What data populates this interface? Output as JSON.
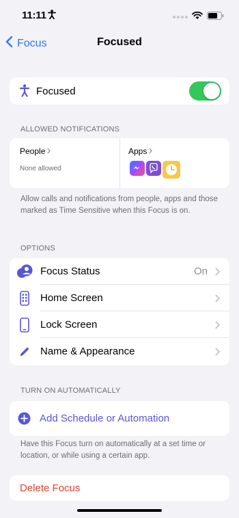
{
  "status_bar": {
    "time": "11:11"
  },
  "nav": {
    "back_label": "Focus",
    "title": "Focused"
  },
  "focus_toggle": {
    "label": "Focused",
    "enabled": true,
    "color": "#34c759"
  },
  "allowed_notifications": {
    "header": "ALLOWED NOTIFICATIONS",
    "people": {
      "title": "People",
      "subtitle": "None allowed"
    },
    "apps": {
      "title": "Apps",
      "icons": [
        "messenger-icon",
        "viber-icon",
        "clock-app-icon"
      ]
    },
    "footer": "Allow calls and notifications from people, apps and those marked as Time Sensitive when this Focus is on."
  },
  "options": {
    "header": "OPTIONS",
    "items": [
      {
        "label": "Focus Status",
        "value": "On",
        "icon": "focus-status-icon"
      },
      {
        "label": "Home Screen",
        "value": "",
        "icon": "home-screen-icon"
      },
      {
        "label": "Lock Screen",
        "value": "",
        "icon": "lock-screen-icon"
      },
      {
        "label": "Name & Appearance",
        "value": "",
        "icon": "pencil-icon"
      }
    ]
  },
  "turn_on_automatically": {
    "header": "TURN ON AUTOMATICALLY",
    "add_label": "Add Schedule or Automation",
    "footer": "Have this Focus turn on automatically at a set time or location, or while using a certain app."
  },
  "delete": {
    "label": "Delete Focus",
    "color": "#e0412f"
  },
  "colors": {
    "accent": "#5856d6",
    "link": "#3478f6",
    "background": "#f2f2f7"
  }
}
